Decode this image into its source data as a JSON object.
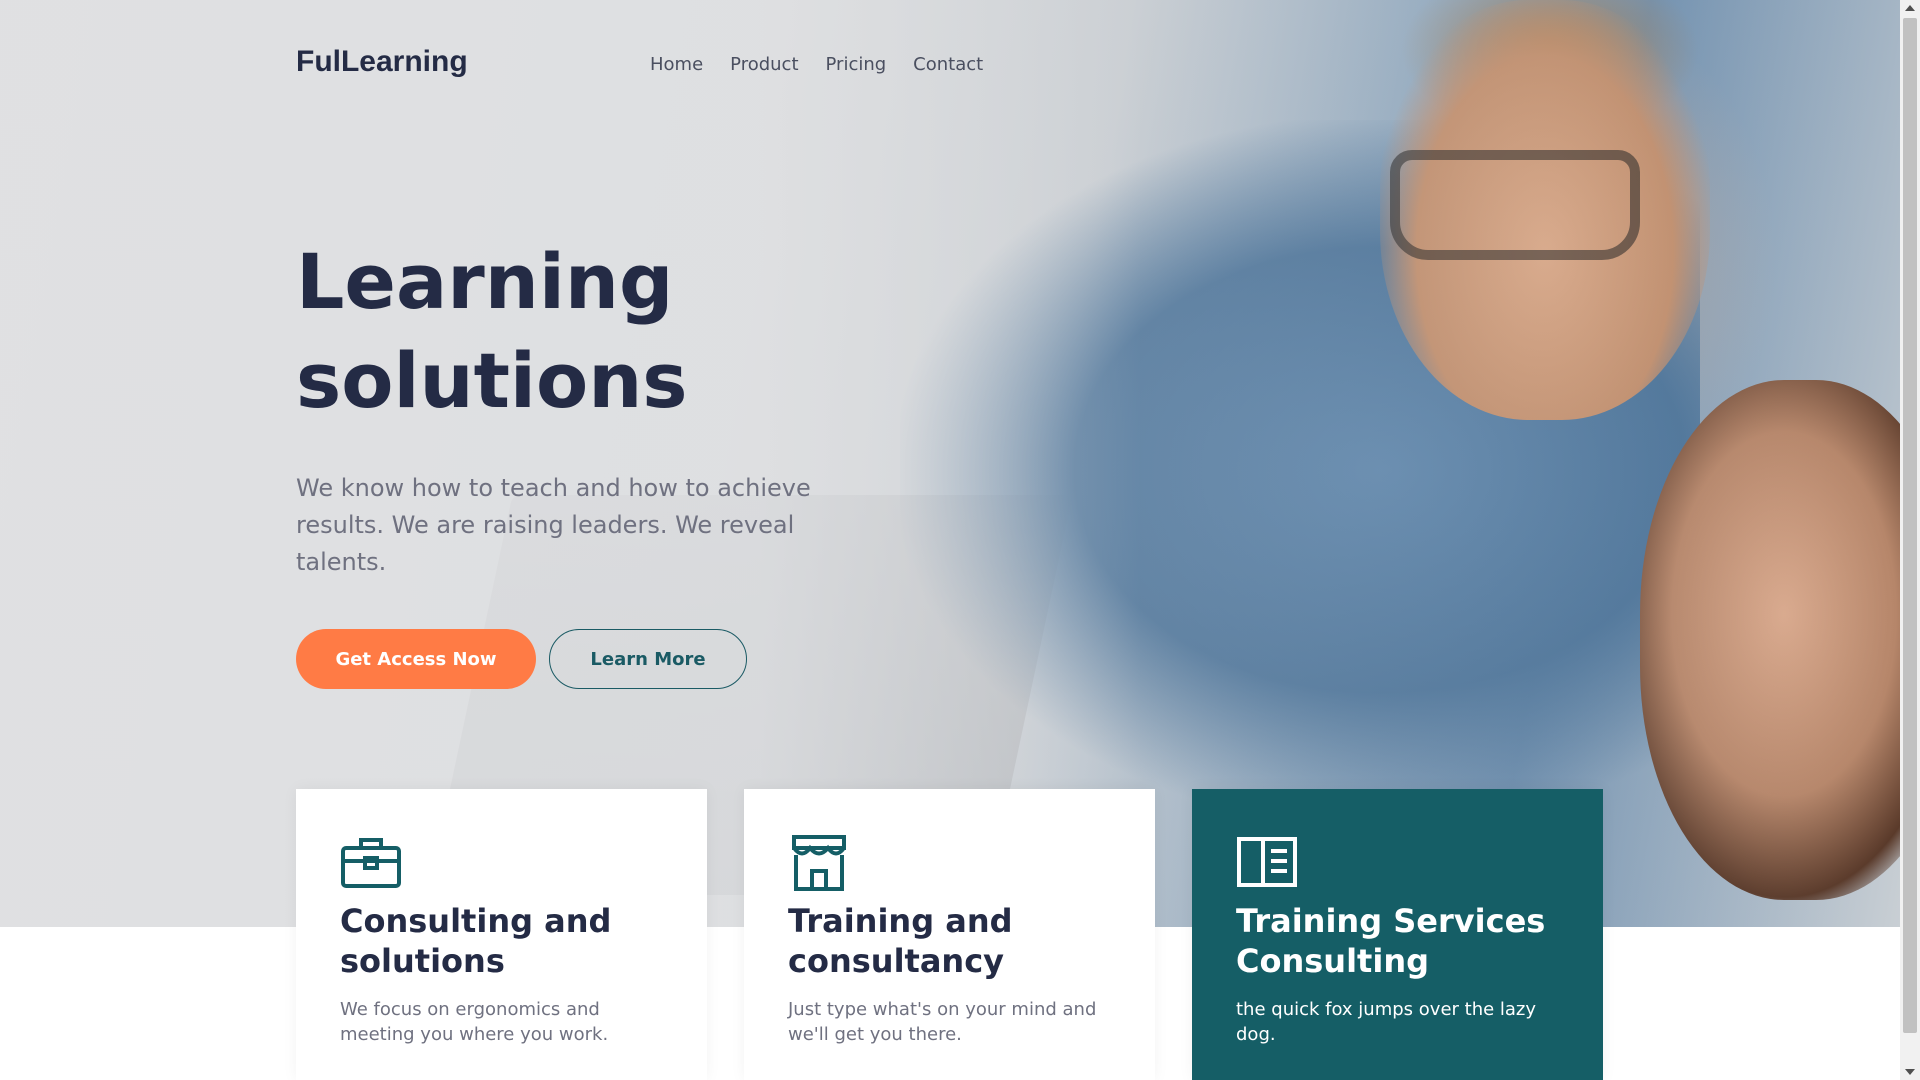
{
  "brand": {
    "logo": "FulLearning"
  },
  "nav": {
    "items": [
      {
        "label": "Home"
      },
      {
        "label": "Product"
      },
      {
        "label": "Pricing"
      },
      {
        "label": "Contact"
      }
    ]
  },
  "hero": {
    "title_line1": "Learning",
    "title_line2": "solutions",
    "subtitle": "We know how to teach and how to achieve results. We are raising leaders. We reveal talents.",
    "primary_button": "Get Access Now",
    "secondary_button": "Learn More"
  },
  "cards": [
    {
      "icon": "briefcase-icon",
      "title": "Consulting and solutions",
      "text": "We focus on ergonomics and meeting you where you work."
    },
    {
      "icon": "storefront-icon",
      "title": "Training and consultancy",
      "text": "Just type what's on your mind and we'll get you there."
    },
    {
      "icon": "book-open-icon",
      "title": "Training Services Consulting",
      "text": "the quick fox jumps over the lazy dog."
    }
  ],
  "colors": {
    "accent": "#ff7b45",
    "teal": "#155e66",
    "heading": "#242b45",
    "body": "#6f7180"
  }
}
